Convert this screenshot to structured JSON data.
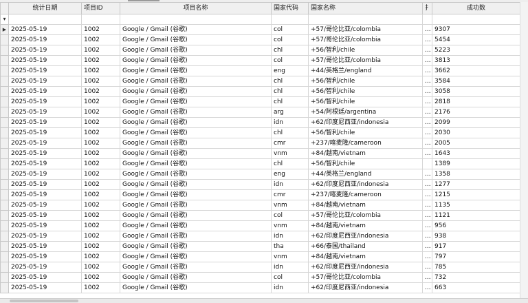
{
  "columns": {
    "date": "统计日期",
    "project_id": "项目ID",
    "project_name": "项目名称",
    "country_code": "国家代码",
    "country_name": "国家名称",
    "col_extra": "扌",
    "success_count": "成功数"
  },
  "grid": {
    "filter_icon": "filter-icon",
    "row_indicator_icon": "current-row-arrow-icon",
    "truncated_cell": "..."
  },
  "rows": [
    {
      "date": "2025-05-19",
      "project_id": "1002",
      "project_name": "Google / Gmail (谷歌)",
      "country_code": "col",
      "country_name": "+57/哥伦比亚/colombia",
      "extra": "...",
      "success": "9307"
    },
    {
      "date": "2025-05-19",
      "project_id": "1002",
      "project_name": "Google / Gmail (谷歌)",
      "country_code": "col",
      "country_name": "+57/哥伦比亚/colombia",
      "extra": "...",
      "success": "5454"
    },
    {
      "date": "2025-05-19",
      "project_id": "1002",
      "project_name": "Google / Gmail (谷歌)",
      "country_code": "chl",
      "country_name": "+56/智利/chile",
      "extra": "...",
      "success": "5223"
    },
    {
      "date": "2025-05-19",
      "project_id": "1002",
      "project_name": "Google / Gmail (谷歌)",
      "country_code": "col",
      "country_name": "+57/哥伦比亚/colombia",
      "extra": "...",
      "success": "3813"
    },
    {
      "date": "2025-05-19",
      "project_id": "1002",
      "project_name": "Google / Gmail (谷歌)",
      "country_code": "eng",
      "country_name": "+44/英格兰/england",
      "extra": "...",
      "success": "3662"
    },
    {
      "date": "2025-05-19",
      "project_id": "1002",
      "project_name": "Google / Gmail (谷歌)",
      "country_code": "chl",
      "country_name": "+56/智利/chile",
      "extra": "...",
      "success": "3584"
    },
    {
      "date": "2025-05-19",
      "project_id": "1002",
      "project_name": "Google / Gmail (谷歌)",
      "country_code": "chl",
      "country_name": "+56/智利/chile",
      "extra": "...",
      "success": "3058"
    },
    {
      "date": "2025-05-19",
      "project_id": "1002",
      "project_name": "Google / Gmail (谷歌)",
      "country_code": "chl",
      "country_name": "+56/智利/chile",
      "extra": "...",
      "success": "2818"
    },
    {
      "date": "2025-05-19",
      "project_id": "1002",
      "project_name": "Google / Gmail (谷歌)",
      "country_code": "arg",
      "country_name": "+54/阿根廷/argentina",
      "extra": "...",
      "success": "2176"
    },
    {
      "date": "2025-05-19",
      "project_id": "1002",
      "project_name": "Google / Gmail (谷歌)",
      "country_code": "idn",
      "country_name": "+62/印度尼西亚/indonesia",
      "extra": "...",
      "success": "2099"
    },
    {
      "date": "2025-05-19",
      "project_id": "1002",
      "project_name": "Google / Gmail (谷歌)",
      "country_code": "chl",
      "country_name": "+56/智利/chile",
      "extra": "...",
      "success": "2030"
    },
    {
      "date": "2025-05-19",
      "project_id": "1002",
      "project_name": "Google / Gmail (谷歌)",
      "country_code": "cmr",
      "country_name": "+237/喀麦隆/cameroon",
      "extra": "...",
      "success": "2005"
    },
    {
      "date": "2025-05-19",
      "project_id": "1002",
      "project_name": "Google / Gmail (谷歌)",
      "country_code": "vnm",
      "country_name": "+84/越南/vietnam",
      "extra": "...",
      "success": "1643"
    },
    {
      "date": "2025-05-19",
      "project_id": "1002",
      "project_name": "Google / Gmail (谷歌)",
      "country_code": "chl",
      "country_name": "+56/智利/chile",
      "extra": "",
      "success": "1389"
    },
    {
      "date": "2025-05-19",
      "project_id": "1002",
      "project_name": "Google / Gmail (谷歌)",
      "country_code": "eng",
      "country_name": "+44/英格兰/england",
      "extra": "...",
      "success": "1358"
    },
    {
      "date": "2025-05-19",
      "project_id": "1002",
      "project_name": "Google / Gmail (谷歌)",
      "country_code": "idn",
      "country_name": "+62/印度尼西亚/indonesia",
      "extra": "...",
      "success": "1277"
    },
    {
      "date": "2025-05-19",
      "project_id": "1002",
      "project_name": "Google / Gmail (谷歌)",
      "country_code": "cmr",
      "country_name": "+237/喀麦隆/cameroon",
      "extra": "...",
      "success": "1215"
    },
    {
      "date": "2025-05-19",
      "project_id": "1002",
      "project_name": "Google / Gmail (谷歌)",
      "country_code": "vnm",
      "country_name": "+84/越南/vietnam",
      "extra": "...",
      "success": "1135"
    },
    {
      "date": "2025-05-19",
      "project_id": "1002",
      "project_name": "Google / Gmail (谷歌)",
      "country_code": "col",
      "country_name": "+57/哥伦比亚/colombia",
      "extra": "...",
      "success": "1121"
    },
    {
      "date": "2025-05-19",
      "project_id": "1002",
      "project_name": "Google / Gmail (谷歌)",
      "country_code": "vnm",
      "country_name": "+84/越南/vietnam",
      "extra": "...",
      "success": "956"
    },
    {
      "date": "2025-05-19",
      "project_id": "1002",
      "project_name": "Google / Gmail (谷歌)",
      "country_code": "idn",
      "country_name": "+62/印度尼西亚/indonesia",
      "extra": "...",
      "success": "938"
    },
    {
      "date": "2025-05-19",
      "project_id": "1002",
      "project_name": "Google / Gmail (谷歌)",
      "country_code": "tha",
      "country_name": "+66/泰国/thailand",
      "extra": "...",
      "success": "917"
    },
    {
      "date": "2025-05-19",
      "project_id": "1002",
      "project_name": "Google / Gmail (谷歌)",
      "country_code": "vnm",
      "country_name": "+84/越南/vietnam",
      "extra": "...",
      "success": "797"
    },
    {
      "date": "2025-05-19",
      "project_id": "1002",
      "project_name": "Google / Gmail (谷歌)",
      "country_code": "idn",
      "country_name": "+62/印度尼西亚/indonesia",
      "extra": "...",
      "success": "785"
    },
    {
      "date": "2025-05-19",
      "project_id": "1002",
      "project_name": "Google / Gmail (谷歌)",
      "country_code": "col",
      "country_name": "+57/哥伦比亚/colombia",
      "extra": "...",
      "success": "732"
    },
    {
      "date": "2025-05-19",
      "project_id": "1002",
      "project_name": "Google / Gmail (谷歌)",
      "country_code": "idn",
      "country_name": "+62/印度尼西亚/indonesia",
      "extra": "...",
      "success": "663"
    }
  ]
}
